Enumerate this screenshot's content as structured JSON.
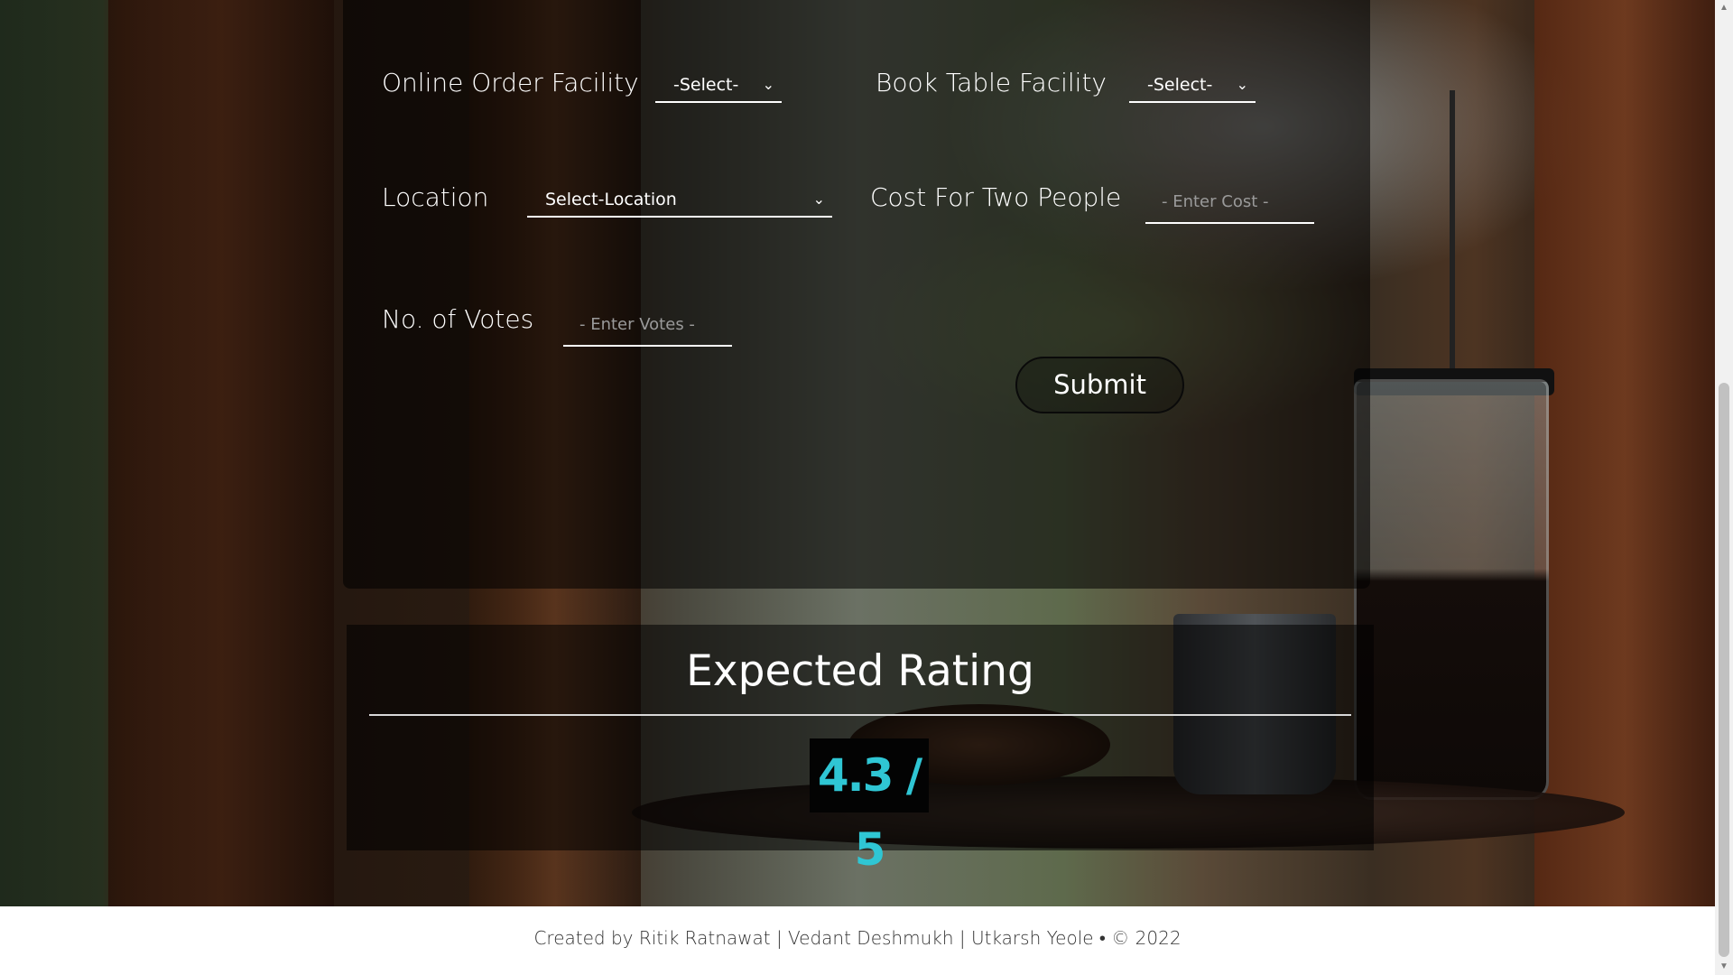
{
  "form": {
    "online_order_label": "Online Order Facility",
    "online_order_value": "-Select-",
    "book_table_label": "Book Table Facility",
    "book_table_value": "-Select-",
    "location_label": "Location",
    "location_value": "Select-Location",
    "cost_label": "Cost For Two People",
    "cost_placeholder": "- Enter Cost -",
    "votes_label": "No. of Votes",
    "votes_placeholder": "- Enter Votes -",
    "submit_label": "Submit"
  },
  "result": {
    "title": "Expected Rating",
    "score": "4.3 / 5"
  },
  "footer": {
    "text": "Created by Ritik Ratnawat | Vedant Deshmukh | Utkarsh Yeole • © 2022"
  },
  "icons": {
    "dropdown": "chevron-down-icon"
  },
  "colors": {
    "score_text": "#2fc6d4",
    "panel_bg": "rgba(0,0,0,0.55)"
  }
}
